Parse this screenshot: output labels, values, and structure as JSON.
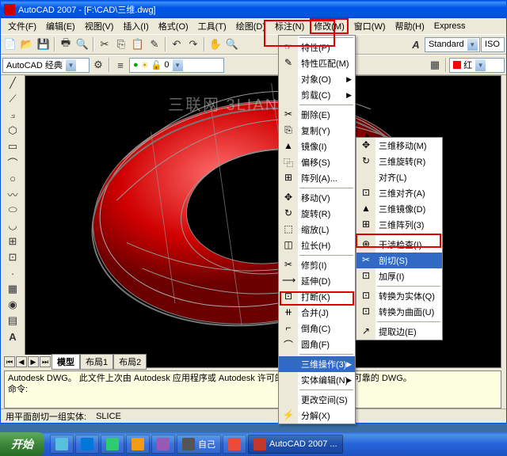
{
  "title": "AutoCAD 2007 - [F:\\CAD\\三维.dwg]",
  "menubar": [
    "文件(F)",
    "编辑(E)",
    "视图(V)",
    "插入(I)",
    "格式(O)",
    "工具(T)",
    "绘图(D)",
    "标注(N)",
    "修改(M)",
    "窗口(W)",
    "帮助(H)",
    "Express"
  ],
  "workspace_combo": "AutoCAD 经典",
  "layer_combo": "0",
  "color_combo": "红",
  "style_combo": "Standard",
  "iso_combo": "ISO",
  "watermark": "三联网 3LIAN.COM",
  "menu1": [
    {
      "t": "sep"
    },
    {
      "t": "i",
      "icon": "☞",
      "label": "特性(P)"
    },
    {
      "t": "i",
      "icon": "✎",
      "label": "特性匹配(M)"
    },
    {
      "t": "i",
      "icon": "",
      "label": "对象(O)",
      "sub": true
    },
    {
      "t": "i",
      "icon": "",
      "label": "剪载(C)",
      "sub": true
    },
    {
      "t": "sep"
    },
    {
      "t": "i",
      "icon": "✂",
      "label": "删除(E)"
    },
    {
      "t": "i",
      "icon": "⎘",
      "label": "复制(Y)"
    },
    {
      "t": "i",
      "icon": "▲",
      "label": "镜像(I)"
    },
    {
      "t": "i",
      "icon": "⿻",
      "label": "偏移(S)"
    },
    {
      "t": "i",
      "icon": "⊞",
      "label": "阵列(A)..."
    },
    {
      "t": "sep"
    },
    {
      "t": "i",
      "icon": "✥",
      "label": "移动(V)"
    },
    {
      "t": "i",
      "icon": "↻",
      "label": "旋转(R)"
    },
    {
      "t": "i",
      "icon": "⬚",
      "label": "缩放(L)"
    },
    {
      "t": "i",
      "icon": "◫",
      "label": "拉长(H)"
    },
    {
      "t": "sep"
    },
    {
      "t": "i",
      "icon": "✂",
      "label": "修剪(I)"
    },
    {
      "t": "i",
      "icon": "⟶",
      "label": "延伸(D)"
    },
    {
      "t": "i",
      "icon": "⊡",
      "label": "打断(K)"
    },
    {
      "t": "i",
      "icon": "⧺",
      "label": "合并(J)"
    },
    {
      "t": "i",
      "icon": "⌐",
      "label": "倒角(C)"
    },
    {
      "t": "i",
      "icon": "⌒",
      "label": "圆角(F)"
    },
    {
      "t": "sep"
    },
    {
      "t": "i",
      "icon": "",
      "label": "三维操作(3)",
      "sub": true,
      "hl": true
    },
    {
      "t": "i",
      "icon": "",
      "label": "实体编辑(N)",
      "sub": true
    },
    {
      "t": "sep"
    },
    {
      "t": "i",
      "icon": "",
      "label": "更改空间(S)"
    },
    {
      "t": "i",
      "icon": "⚡",
      "label": "分解(X)"
    }
  ],
  "menu2": [
    {
      "t": "i",
      "icon": "✥",
      "label": "三维移动(M)"
    },
    {
      "t": "i",
      "icon": "↻",
      "label": "三维旋转(R)"
    },
    {
      "t": "i",
      "icon": "",
      "label": "对齐(L)"
    },
    {
      "t": "i",
      "icon": "⊡",
      "label": "三维对齐(A)"
    },
    {
      "t": "i",
      "icon": "▲",
      "label": "三维镜像(D)"
    },
    {
      "t": "i",
      "icon": "⊞",
      "label": "三维阵列(3)"
    },
    {
      "t": "sep"
    },
    {
      "t": "i",
      "icon": "⊕",
      "label": "干涉检查(I)"
    },
    {
      "t": "i",
      "icon": "✂",
      "label": "剖切(S)",
      "hl": true
    },
    {
      "t": "i",
      "icon": "⊡",
      "label": "加厚(I)"
    },
    {
      "t": "sep"
    },
    {
      "t": "i",
      "icon": "⊡",
      "label": "转换为实体(Q)"
    },
    {
      "t": "i",
      "icon": "⊡",
      "label": "转换为曲面(U)"
    },
    {
      "t": "sep"
    },
    {
      "t": "i",
      "icon": "↗",
      "label": "提取边(E)"
    }
  ],
  "cmdline": {
    "l1": "Autodesk DWG。  此文件上次由 Autodesk 应用程序或 Autodesk 许可的应用程序保存，是可靠的 DWG。",
    "l2": "命令:"
  },
  "status": {
    "l": "用平面剖切一组实体:",
    "r": "SLICE"
  },
  "tabs": {
    "nav": [
      "⏮",
      "◀",
      "▶",
      "⏭"
    ],
    "items": [
      "模型",
      "布局1",
      "布局2"
    ]
  },
  "taskbar": {
    "start": "开始",
    "items": [
      {
        "label": "",
        "color": "#5bc0de"
      },
      {
        "label": "",
        "color": "#0078d7"
      },
      {
        "label": "",
        "color": "#2ecc71"
      },
      {
        "label": "",
        "color": "#f39c12"
      },
      {
        "label": "",
        "color": "#9b59b6"
      },
      {
        "label": "自己",
        "color": "#555"
      },
      {
        "label": "",
        "color": "#e74c3c"
      },
      {
        "label": "AutoCAD 2007 ...",
        "color": "#c0392b",
        "active": true
      }
    ]
  }
}
